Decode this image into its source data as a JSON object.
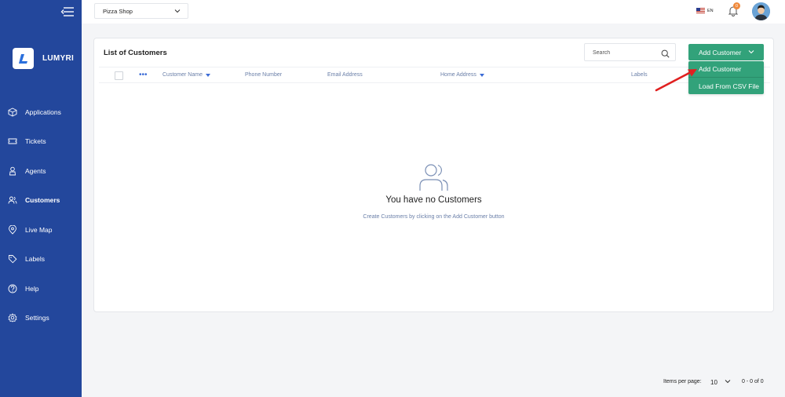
{
  "app": {
    "name": "LUMYRI"
  },
  "sidebar": {
    "items": [
      {
        "label": "Applications",
        "icon": "cube-icon"
      },
      {
        "label": "Tickets",
        "icon": "ticket-icon"
      },
      {
        "label": "Agents",
        "icon": "agent-icon"
      },
      {
        "label": "Customers",
        "icon": "users-icon",
        "active": true
      },
      {
        "label": "Live Map",
        "icon": "map-pin-icon"
      },
      {
        "label": "Labels",
        "icon": "tag-icon"
      },
      {
        "label": "Help",
        "icon": "help-icon"
      },
      {
        "label": "Settings",
        "icon": "gear-icon"
      }
    ]
  },
  "topbar": {
    "shop": "Pizza Shop",
    "language": "EN",
    "notifications_count": "0"
  },
  "main": {
    "title": "List of Customers",
    "search_placeholder": "Search",
    "add_button": "Add Customer",
    "dropdown": [
      "Add Customer",
      "Load From CSV File"
    ],
    "columns": [
      "Customer Name",
      "Phone Number",
      "Email Address",
      "Home Address",
      "Labels"
    ],
    "empty_title": "You have no Customers",
    "empty_subtitle": "Create Customers by clicking on the Add Customer button"
  },
  "pagination": {
    "items_per_page_label": "Items per page:",
    "items_per_page": "10",
    "range": "0 - 0 of 0"
  },
  "colors": {
    "sidebar": "#23479c",
    "accent_green": "#32a27a",
    "badge": "#f08a3c",
    "annotation_arrow": "#e02020"
  }
}
